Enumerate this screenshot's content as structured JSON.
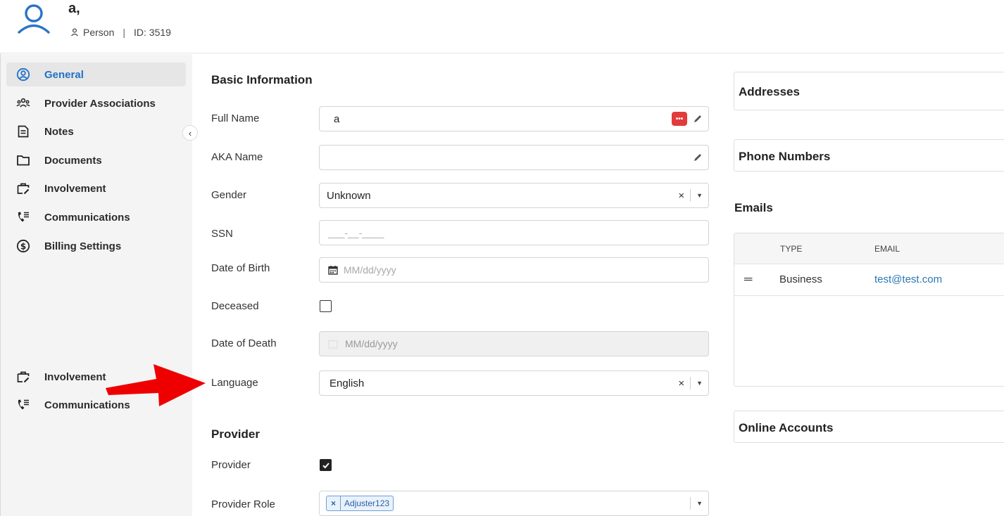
{
  "header": {
    "name": "a,",
    "type_label": "Person",
    "separator": "|",
    "id_label": "ID: 3519"
  },
  "sidebar": {
    "items": [
      {
        "label": "General",
        "icon": "user-circle-icon",
        "active": true
      },
      {
        "label": "Provider Associations",
        "icon": "users-group-icon",
        "active": false
      },
      {
        "label": "Notes",
        "icon": "note-icon",
        "active": false
      },
      {
        "label": "Documents",
        "icon": "folder-icon",
        "active": false
      },
      {
        "label": "Involvement",
        "icon": "briefcase-edit-icon",
        "active": false
      },
      {
        "label": "Communications",
        "icon": "phone-list-icon",
        "active": false
      },
      {
        "label": "Billing Settings",
        "icon": "dollar-circle-icon",
        "active": false
      }
    ],
    "ghost_items": [
      {
        "label": "Involvement",
        "icon": "briefcase-edit-icon"
      },
      {
        "label": "Communications",
        "icon": "phone-list-icon"
      }
    ],
    "collapse_icon": "chevron-left-icon"
  },
  "basic_info": {
    "title": "Basic Information",
    "full_name": {
      "label": "Full Name",
      "value": "a",
      "badge": "•••"
    },
    "aka_name": {
      "label": "AKA Name",
      "value": ""
    },
    "gender": {
      "label": "Gender",
      "value": "Unknown"
    },
    "ssn": {
      "label": "SSN",
      "placeholder": "___-__-____"
    },
    "dob": {
      "label": "Date of Birth",
      "placeholder": "MM/dd/yyyy"
    },
    "deceased": {
      "label": "Deceased",
      "checked": false
    },
    "dod": {
      "label": "Date of Death",
      "placeholder": "MM/dd/yyyy"
    },
    "language": {
      "label": "Language",
      "value": "English"
    }
  },
  "provider": {
    "title": "Provider",
    "provider_flag": {
      "label": "Provider",
      "checked": true
    },
    "role": {
      "label": "Provider Role",
      "chips": [
        "Adjuster123"
      ]
    }
  },
  "right": {
    "addresses_title": "Addresses",
    "phones_title": "Phone Numbers",
    "emails_title": "Emails",
    "emails_columns": [
      "TYPE",
      "EMAIL"
    ],
    "emails_rows": [
      {
        "type": "Business",
        "email": "test@test.com"
      }
    ],
    "online_title": "Online Accounts"
  },
  "colors": {
    "accent": "#1f72c8",
    "annotation_arrow": "#ee0000",
    "badge": "#e23b3b",
    "link": "#2a77b5"
  }
}
